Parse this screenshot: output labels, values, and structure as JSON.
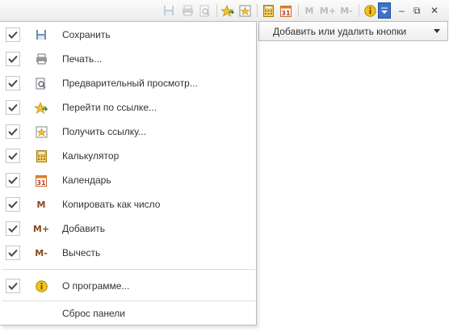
{
  "toolbar": {
    "buttons": [
      {
        "name": "save-icon",
        "enabled": false
      },
      {
        "name": "print-icon",
        "enabled": false
      },
      {
        "name": "print-preview-icon",
        "enabled": false
      },
      {
        "name": "go-to-link-icon",
        "enabled": true
      },
      {
        "name": "get-link-icon",
        "enabled": true
      },
      {
        "name": "calculator-icon",
        "enabled": true
      },
      {
        "name": "calendar-icon",
        "enabled": true
      },
      {
        "name": "m-label",
        "text": "M",
        "enabled": false
      },
      {
        "name": "m-plus-label",
        "text": "M+",
        "enabled": false
      },
      {
        "name": "m-minus-label",
        "text": "M-",
        "enabled": false
      },
      {
        "name": "info-icon",
        "enabled": true
      },
      {
        "name": "toolbar-dropdown-icon",
        "enabled": true
      }
    ],
    "window_controls": {
      "minimize": "–",
      "restore": "⧉",
      "close": "✕"
    }
  },
  "combo": {
    "label": "Добавить или удалить кнопки"
  },
  "menu": {
    "items": [
      {
        "label": "Сохранить",
        "checked": true,
        "icon": "save-icon",
        "underline_index": 0
      },
      {
        "label": "Печать...",
        "checked": true,
        "icon": "print-icon",
        "underline_index": 0
      },
      {
        "label": "Предварительный просмотр...",
        "checked": true,
        "icon": "print-preview-icon"
      },
      {
        "label": "Перейти по ссылке...",
        "checked": true,
        "icon": "go-to-link-icon"
      },
      {
        "label": "Получить ссылку...",
        "checked": true,
        "icon": "get-link-icon"
      },
      {
        "label": "Калькулятор",
        "checked": true,
        "icon": "calculator-icon",
        "underline_index": 0
      },
      {
        "label": "Календарь",
        "checked": true,
        "icon": "calendar-icon"
      },
      {
        "label": "Копировать как число",
        "checked": true,
        "icon": "m-icon",
        "icon_text": "M"
      },
      {
        "label": "Добавить",
        "checked": true,
        "icon": "m-plus-icon",
        "icon_text": "M+"
      },
      {
        "label": "Вычесть",
        "checked": true,
        "icon": "m-minus-icon",
        "icon_text": "M-"
      },
      {
        "label": "О программе...",
        "checked": true,
        "icon": "info-icon"
      }
    ],
    "reset_label": "Сброс панели"
  },
  "colors": {
    "accent": "#3d73c7",
    "menu_icon_brown": "#8a4a1a",
    "info_yellow": "#f2c21a"
  }
}
